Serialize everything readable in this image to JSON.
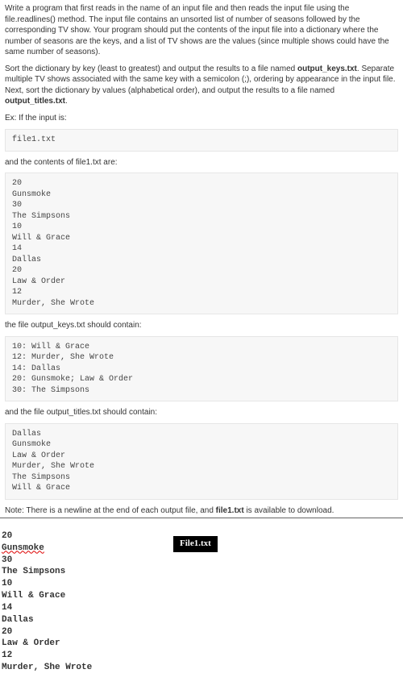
{
  "p1_a": "Write a program that first reads in the name of an input file and then reads the input file using the file.readlines() method. The input file contains an unsorted list of number of seasons followed by the corresponding TV show. Your program should put the contents of the input file into a dictionary where the number of seasons are the keys, and a list of TV shows are the values (since multiple shows could have the same number of seasons).",
  "p2_a": "Sort the dictionary by key (least to greatest) and output the results to a file named ",
  "p2_b": "output_keys.txt",
  "p2_c": ". Separate multiple TV shows associated with the same key with a semicolon (;), ordering by appearance in the input file. Next, sort the dictionary by values (alphabetical order), and output the results to a file named ",
  "p2_d": "output_titles.txt",
  "p2_e": ".",
  "ex_label": "Ex: If the input is:",
  "code1": "file1.txt",
  "cap1": "and the contents of file1.txt are:",
  "code2": "20\nGunsmoke\n30\nThe Simpsons\n10\nWill & Grace\n14\nDallas\n20\nLaw & Order\n12\nMurder, She Wrote",
  "cap2": "the file output_keys.txt should contain:",
  "code3": "10: Will & Grace\n12: Murder, She Wrote\n14: Dallas\n20: Gunsmoke; Law & Order\n30: The Simpsons",
  "cap3": "and the file output_titles.txt should contain:",
  "code4": "Dallas\nGunsmoke\nLaw & Order\nMurder, She Wrote\nThe Simpsons\nWill & Grace",
  "note_a": "Note: There is a newline at the end of each output file, and ",
  "note_b": "file1.txt",
  "note_c": " is available to download.",
  "raw_l1": "20",
  "raw_gun": "Gunsmoke",
  "raw_l3": "30",
  "raw_l4": "The Simpsons",
  "raw_l5": "10",
  "raw_l6": "Will & Grace",
  "raw_l7": "14",
  "raw_l8": "Dallas",
  "raw_l9": "20",
  "raw_l10": "Law & Order",
  "raw_l11": "12",
  "raw_l12": "Murder, She Wrote",
  "chip": "File1.txt"
}
